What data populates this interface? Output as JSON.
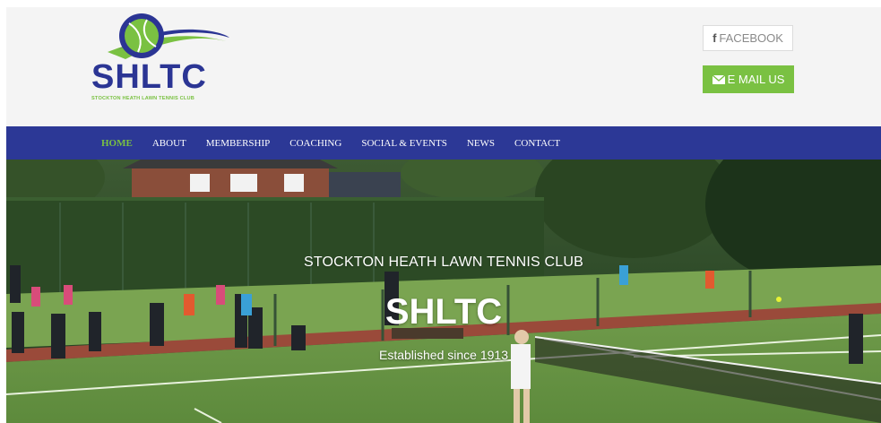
{
  "header": {
    "logo": {
      "abbr": "SHLTC",
      "tagline": "STOCKTON HEATH LAWN TENNIS CLUB"
    },
    "facebook_label": "FACEBOOK",
    "email_label": "E MAIL US"
  },
  "nav": {
    "items": [
      {
        "label": "HOME",
        "active": true
      },
      {
        "label": "ABOUT"
      },
      {
        "label": "MEMBERSHIP"
      },
      {
        "label": "COACHING"
      },
      {
        "label": "SOCIAL & EVENTS"
      },
      {
        "label": "NEWS"
      },
      {
        "label": "CONTACT"
      }
    ]
  },
  "hero": {
    "title": "STOCKTON HEATH LAWN TENNIS CLUB",
    "abbr": "SHLTC",
    "subtitle": "Established since 1913"
  },
  "colors": {
    "brand_blue": "#2c3896",
    "brand_green": "#7ac142",
    "header_bg": "#f4f4f4"
  },
  "icons": [
    "facebook-icon",
    "envelope-icon",
    "tennis-ball-logo-icon"
  ]
}
